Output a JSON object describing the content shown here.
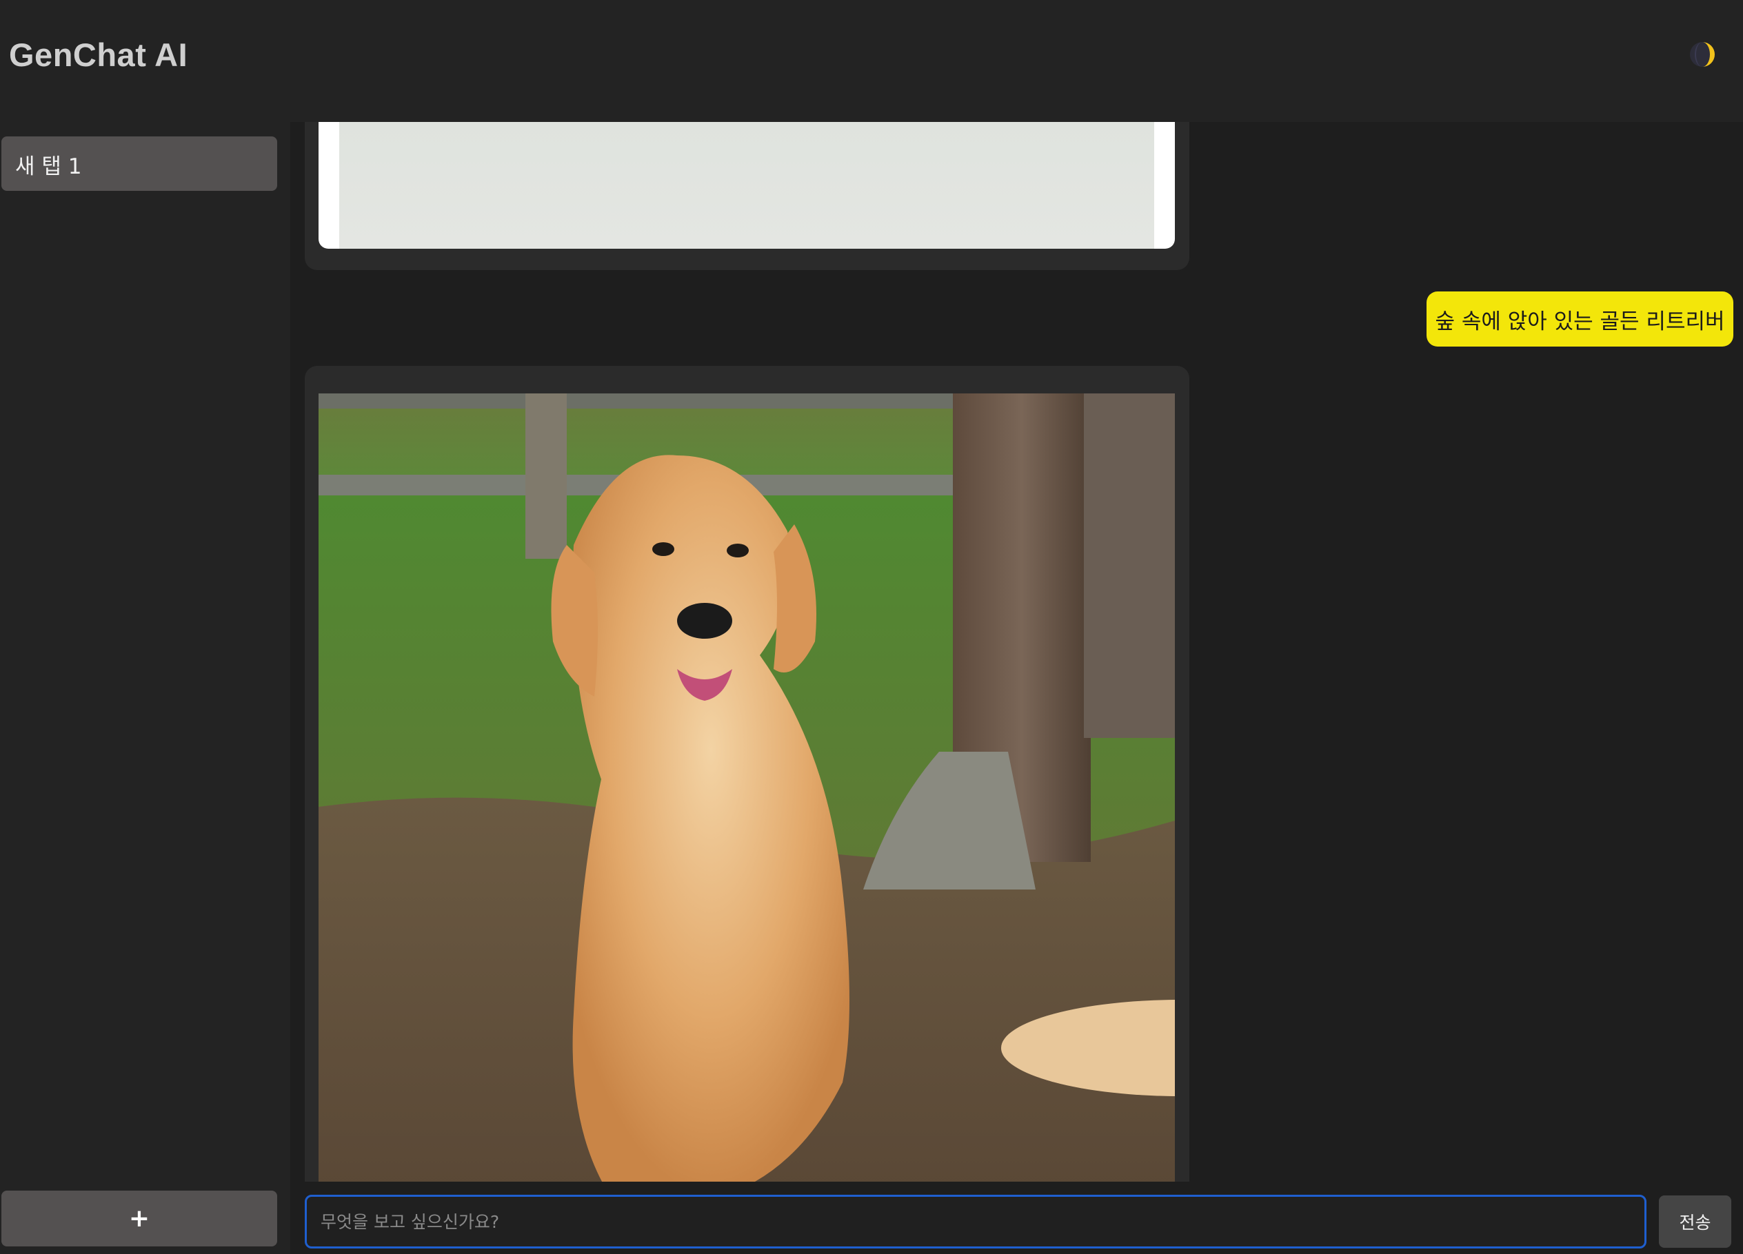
{
  "app": {
    "title": "GenChat AI"
  },
  "header": {
    "theme_toggle_icon": "half-moon-icon"
  },
  "sidebar": {
    "tabs": [
      {
        "label": "새 탭 1",
        "active": true
      }
    ],
    "add_tab_label": "+"
  },
  "chat": {
    "messages": [
      {
        "role": "assistant",
        "type": "image",
        "content": "generated-image"
      },
      {
        "role": "user",
        "type": "text",
        "text": "숲 속에 앉아 있는 골든 리트리버"
      },
      {
        "role": "assistant",
        "type": "image",
        "content": "generated-image-golden-retriever"
      }
    ]
  },
  "composer": {
    "placeholder": "무엇을 보고 싶으신가요?",
    "value": "",
    "send_label": "전송"
  },
  "colors": {
    "background": "#1e1e1e",
    "panel": "#232323",
    "tab_active": "#545151",
    "user_bubble": "#f3e60a",
    "input_border": "#1f5fcf"
  }
}
